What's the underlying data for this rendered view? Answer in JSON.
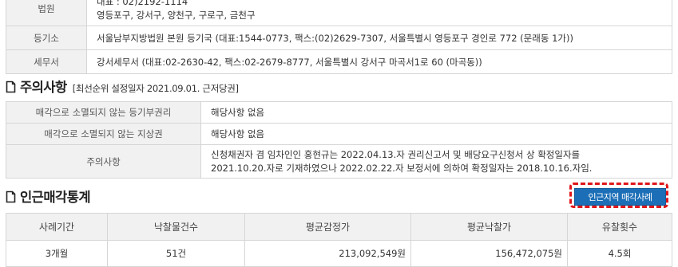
{
  "court_table": {
    "rows": [
      {
        "label": "법원",
        "lines": [
          "대표 : 02)2192-1114",
          "영등포구, 강서구, 양천구, 구로구, 금천구"
        ]
      },
      {
        "label": "등기소",
        "lines": [
          "서울남부지방법원 본원 등기국 (대표:1544-0773, 팩스:(02)2629-7307, 서울특별시 영등포구 경인로 772 (문래동 1가))"
        ]
      },
      {
        "label": "세무서",
        "lines": [
          "강서세무서 (대표:02-2630-42, 팩스:02-2679-8777, 서울특별시 강서구 마곡서1로 60 (마곡동))"
        ]
      }
    ]
  },
  "notice": {
    "title": "주의사항",
    "subtitle": "[최선순위 설정일자 2021.09.01. 근저당권]",
    "rows": [
      {
        "label": "매각으로 소멸되지 않는 등기부권리",
        "value": "해당사항 없음"
      },
      {
        "label": "매각으로 소멸되지 않는 지상권",
        "value": "해당사항 없음"
      },
      {
        "label": "주의사항",
        "value": "신청채권자 겸 임차인인 홍현규는 2022.04.13.자 권리신고서 및 배당요구신청서 상 확정일자를 2021.10.20.자로 기재하였으나 2022.02.22.자 보정서에 의하여 확정일자는 2018.10.16.자임."
      }
    ]
  },
  "stats": {
    "title": "인근매각통계",
    "button_label": "인근지역 매각사례",
    "columns": [
      "사례기간",
      "낙찰물건수",
      "평균감정가",
      "평균낙찰가",
      "유찰횟수"
    ],
    "rows": [
      [
        "3개월",
        "51건",
        "213,092,549원",
        "156,472,075원",
        "4.5회"
      ]
    ]
  },
  "colors": {
    "button": "#1c6fb7",
    "highlight": "#e0161b",
    "label_bg": "#f1f1f1"
  }
}
